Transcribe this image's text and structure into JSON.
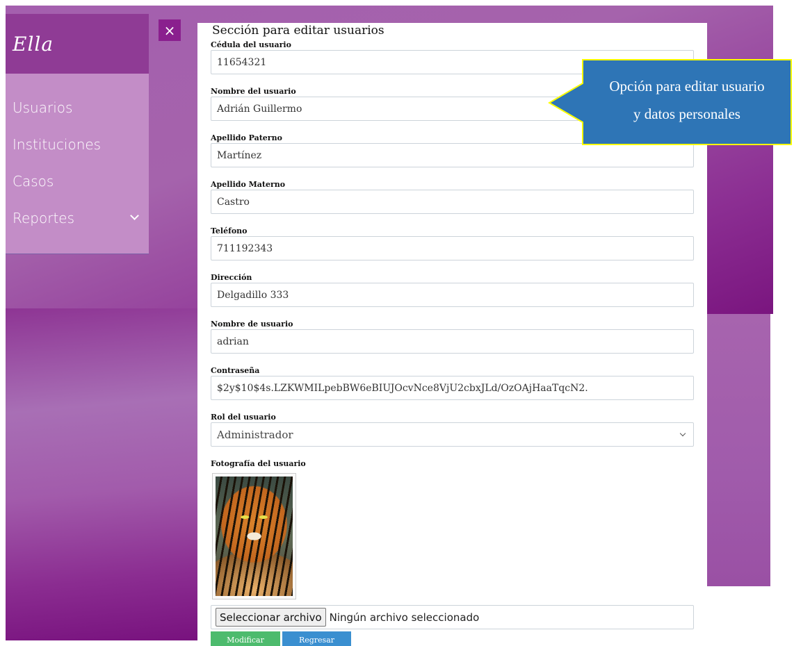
{
  "sidebar": {
    "logo": "Ella",
    "items": [
      {
        "label": "Usuarios"
      },
      {
        "label": "Instituciones"
      },
      {
        "label": "Casos"
      },
      {
        "label": "Reportes"
      }
    ]
  },
  "close_label": "×",
  "form": {
    "title": "Sección para editar usuarios",
    "fields": [
      {
        "label": "Cédula del usuario",
        "value": "11654321"
      },
      {
        "label": "Nombre del usuario",
        "value": "Adrián Guillermo"
      },
      {
        "label": "Apellido Paterno",
        "value": "Martínez"
      },
      {
        "label": "Apellido Materno",
        "value": "Castro"
      },
      {
        "label": "Teléfono",
        "value": "711192343"
      },
      {
        "label": "Dirección",
        "value": "Delgadillo 333"
      },
      {
        "label": "Nombre de usuario",
        "value": "adrian"
      },
      {
        "label": "Contraseña",
        "value": "$2y$10$4s.LZKWMILpebBW6eBIUJOcvNce8VjU2cbxJLd/OzOAjHaaTqcN2."
      }
    ],
    "role": {
      "label": "Rol del usuario",
      "selected": "Administrador"
    },
    "photo": {
      "label": "Fotografía del usuario"
    },
    "file": {
      "button": "Seleccionar archivo",
      "status": "Ningún archivo seleccionado"
    },
    "buttons": {
      "modify": "Modificar",
      "back": "Regresar"
    }
  },
  "callout": {
    "line1": "Opción para editar usuario",
    "line2": "y datos personales",
    "fill": "#2e75b6",
    "border": "#ffff00"
  },
  "colors": {
    "sidebar_head": "#8f3b95",
    "sidebar_menu": "#c38dc7",
    "close_button": "#8a1f8e",
    "modify_button": "#4dbb6d",
    "back_button": "#3a8fd0"
  }
}
